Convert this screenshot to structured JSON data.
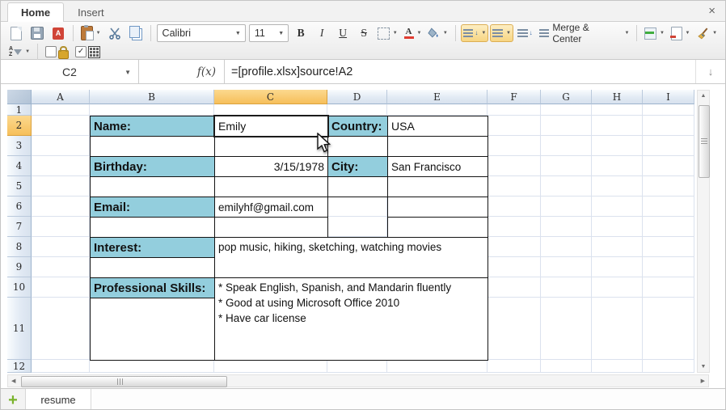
{
  "window": {
    "close": "×"
  },
  "ribbon": {
    "tabs": [
      {
        "label": "Home",
        "active": true
      },
      {
        "label": "Insert",
        "active": false
      }
    ]
  },
  "toolbar": {
    "font_name": "Calibri",
    "font_size": "11",
    "bold": "B",
    "italic": "I",
    "underline": "U",
    "strikethrough": "S",
    "font_color_letter": "A",
    "merge_center": "Merge & Center",
    "sort_a": "A",
    "sort_z": "Z"
  },
  "formula_bar": {
    "cell_reference": "C2",
    "fx": "f(x)",
    "formula": "=[profile.xlsx]source!A2"
  },
  "grid": {
    "columns": [
      "A",
      "B",
      "C",
      "D",
      "E",
      "F",
      "G",
      "H",
      "I"
    ],
    "rows": [
      "1",
      "2",
      "3",
      "4",
      "5",
      "6",
      "7",
      "8",
      "9",
      "10",
      "11",
      "12"
    ],
    "selected_column": "C",
    "selected_row": "2",
    "cells": {
      "B2": "Name:",
      "C2": "Emily",
      "D2": "Country:",
      "E2": "USA",
      "B4": "Birthday:",
      "C4": "3/15/1978",
      "D4": "City:",
      "E4": "San Francisco",
      "B6": "Email:",
      "C6": "emilyhf@gmail.com",
      "B8": "Interest:",
      "C8": "pop music, hiking, sketching, watching movies",
      "B10": "Professional Skills:",
      "C10": [
        "* Speak English, Spanish, and Mandarin fluently",
        "* Good at using Microsoft Office 2010",
        "* Have car license"
      ]
    }
  },
  "sheet_bar": {
    "add": "+",
    "tabs": [
      {
        "label": "resume",
        "active": true
      }
    ]
  },
  "colors": {
    "label_fill": "#93cedd",
    "selected_header_top": "#fcd98f",
    "selected_header_bottom": "#f6bf5a",
    "selection_border": "#1b1b1b",
    "add_button_green": "#7ab32c"
  }
}
